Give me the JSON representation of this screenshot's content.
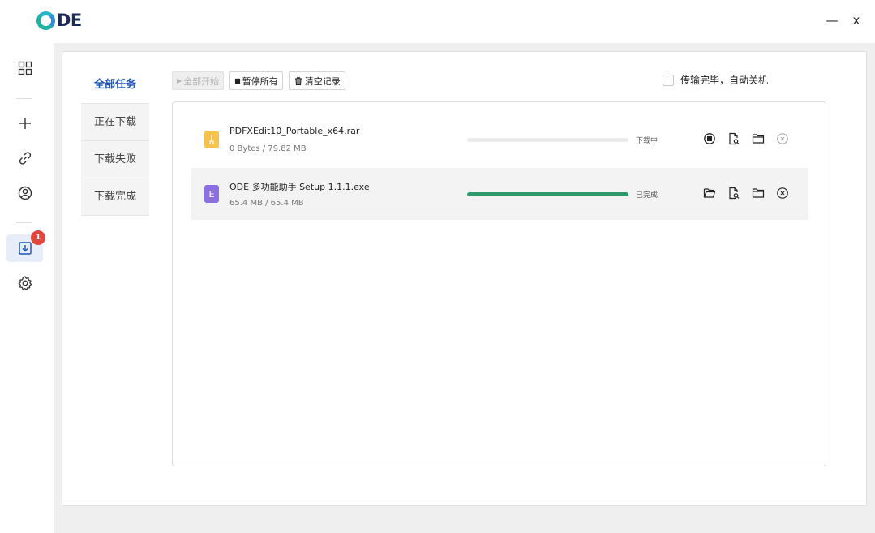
{
  "app": {
    "logo_text": "DE"
  },
  "window": {
    "minimize_label": "—",
    "close_label": "x"
  },
  "nav": {
    "items": [
      {
        "name": "apps-icon"
      },
      {
        "name": "add-icon"
      },
      {
        "name": "link-icon"
      },
      {
        "name": "user-icon"
      },
      {
        "name": "download-icon",
        "badge": "1"
      },
      {
        "name": "gear-icon"
      }
    ]
  },
  "tabs": [
    {
      "label": "全部任务",
      "active": true
    },
    {
      "label": "正在下载",
      "active": false
    },
    {
      "label": "下载失败",
      "active": false
    },
    {
      "label": "下载完成",
      "active": false
    }
  ],
  "toolbar": {
    "start_all": "全部开始",
    "pause_all": "暂停所有",
    "clear": "清空记录"
  },
  "shutdown_label": "传输完毕，自动关机",
  "downloads": [
    {
      "icon": "rar-file-icon",
      "name": "PDFXEdit10_Portable_x64.rar",
      "size": "0 Bytes / 79.82 MB",
      "progress": 0,
      "status": "下载中"
    },
    {
      "icon": "exe-file-icon",
      "name": "ODE 多功能助手 Setup 1.1.1.exe",
      "size": "65.4 MB / 65.4 MB",
      "progress": 1,
      "status": "已完成"
    }
  ],
  "colors": {
    "accent": "#1f56b8",
    "progress": "#2e9a6b",
    "badge": "#e0463c"
  }
}
